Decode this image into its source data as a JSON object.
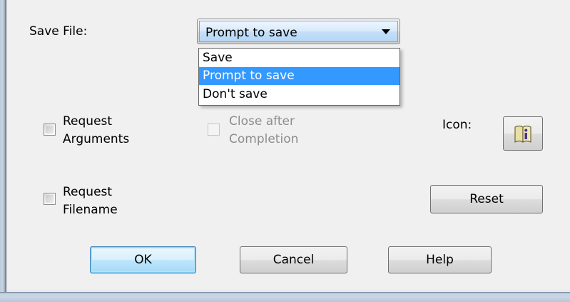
{
  "dialog": {
    "save_file_label": "Save File:",
    "save_file_value": "Prompt to save",
    "save_file_options": [
      "Save",
      "Prompt to save",
      "Don't save"
    ],
    "save_file_selected_index": 1,
    "request_arguments_line1": "Request",
    "request_arguments_line2": "Arguments",
    "request_arguments_checked": false,
    "close_after_line1": "Close after",
    "close_after_line2": "Completion",
    "close_after_checked": false,
    "close_after_enabled": false,
    "request_filename_line1": "Request",
    "request_filename_line2": "Filename",
    "request_filename_checked": false,
    "icon_label": "Icon:",
    "icon_name": "info-book-icon",
    "reset_label": "Reset",
    "ok_label": "OK",
    "cancel_label": "Cancel",
    "help_label": "Help"
  },
  "colors": {
    "selection": "#3399ff",
    "dialog_bg": "#f0f0f0",
    "disabled_text": "#8d8d8d",
    "default_button_border": "#3c7fb1"
  }
}
